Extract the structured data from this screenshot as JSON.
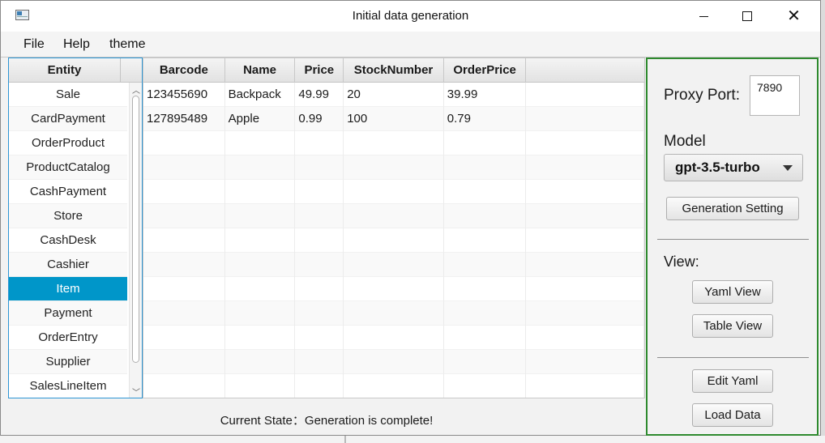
{
  "window": {
    "title": "Initial data generation",
    "close_glyph": "✕"
  },
  "menu": [
    "File",
    "Help",
    "theme"
  ],
  "entity_panel": {
    "header": "Entity",
    "items": [
      "Sale",
      "CardPayment",
      "OrderProduct",
      "ProductCatalog",
      "CashPayment",
      "Store",
      "CashDesk",
      "Cashier",
      "Item",
      "Payment",
      "OrderEntry",
      "Supplier",
      "SalesLineItem"
    ],
    "selected": "Item",
    "scroll_up_glyph": "︿",
    "scroll_down_glyph": "﹀"
  },
  "table": {
    "columns": [
      "Barcode",
      "Name",
      "Price",
      "StockNumber",
      "OrderPrice"
    ],
    "rows": [
      [
        "123455690",
        "Backpack",
        "49.99",
        "20",
        "39.99"
      ],
      [
        "127895489",
        "Apple",
        "0.99",
        "100",
        "0.79"
      ]
    ]
  },
  "status": {
    "text": "Current State：Generation is complete!"
  },
  "side_panel": {
    "proxy_label": "Proxy Port:",
    "proxy_value": "7890",
    "model_label": "Model",
    "model_value": "gpt-3.5-turbo",
    "generation_setting_button": "Generation Setting",
    "view_label": "View:",
    "yaml_view_button": "Yaml View",
    "table_view_button": "Table View",
    "edit_yaml_button": "Edit Yaml",
    "load_data_button": "Load Data"
  },
  "colors": {
    "selection": "#0096c9",
    "entity_border": "#2c95d4",
    "side_border": "#2e8a2e"
  }
}
